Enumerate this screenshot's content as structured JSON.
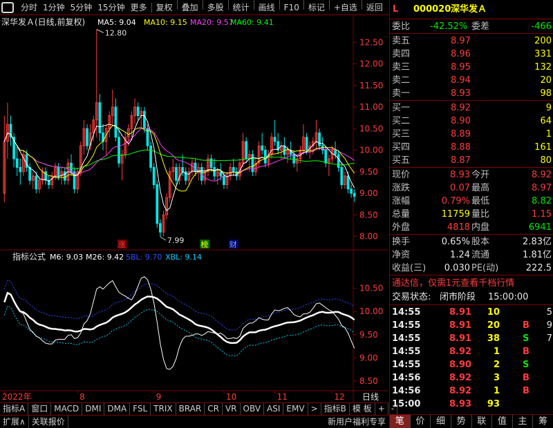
{
  "toolbar": {
    "periods": [
      "分时",
      "1分钟",
      "5分钟",
      "15分钟",
      "更多"
    ],
    "tools": [
      "复权",
      "叠加",
      "多股",
      "统计",
      "画线",
      "F10",
      "标记",
      "+自选",
      "返回"
    ]
  },
  "main_header": {
    "title": "深华发Ａ(日线,前复权)",
    "ma5": "MA5: 9.04",
    "ma10": "MA10: 9.15",
    "ma20": "MA20: 9.57",
    "ma60": "MA60: 9.41"
  },
  "sub_header": {
    "title": "指标公式",
    "m6": "M6: 9.03",
    "m26": "M26: 9.42",
    "sbl": "SBL: 9.70",
    "xbl": "XBL: 9.14"
  },
  "annotations": {
    "high": "12.80",
    "low": "7.99",
    "tag_zhang": "涨",
    "tag_bang": "榜",
    "tag_cai": "财"
  },
  "colors": {
    "up": "#ff3c3c",
    "down": "#00e6e6",
    "ma5": "#ffffff",
    "ma10": "#ffff00",
    "ma20": "#ff40ff",
    "ma60": "#00ff00"
  },
  "chart_data": [
    {
      "type": "candlestick",
      "title": "深华发Ａ(日线,前复权)",
      "yticks": [
        8.0,
        8.5,
        9.0,
        9.5,
        10.0,
        10.5,
        11.0,
        11.5,
        12.0,
        12.5
      ],
      "ylim": [
        7.8,
        13.0
      ],
      "x_labels": [
        "2022年",
        "8",
        "9",
        "10",
        "11",
        "12"
      ],
      "x_label_positions": [
        0,
        23,
        47,
        69,
        85,
        103
      ],
      "candles": [
        [
          9.0,
          10.8,
          8.8,
          10.2
        ],
        [
          10.2,
          11.1,
          9.8,
          10.6
        ],
        [
          10.6,
          10.8,
          10.1,
          10.3
        ],
        [
          10.3,
          10.4,
          9.6,
          9.8
        ],
        [
          9.8,
          10.1,
          9.4,
          9.6
        ],
        [
          9.6,
          9.8,
          9.2,
          9.5
        ],
        [
          9.5,
          10.0,
          9.4,
          9.9
        ],
        [
          9.9,
          10.0,
          9.5,
          9.6
        ],
        [
          9.6,
          9.7,
          9.2,
          9.3
        ],
        [
          9.3,
          9.5,
          9.1,
          9.4
        ],
        [
          9.4,
          9.5,
          9.0,
          9.1
        ],
        [
          9.1,
          9.4,
          9.0,
          9.3
        ],
        [
          9.3,
          9.6,
          9.2,
          9.5
        ],
        [
          9.5,
          9.6,
          9.2,
          9.3
        ],
        [
          9.3,
          9.4,
          9.1,
          9.2
        ],
        [
          9.2,
          9.5,
          9.1,
          9.4
        ],
        [
          9.4,
          9.7,
          9.3,
          9.6
        ],
        [
          9.6,
          9.7,
          9.3,
          9.4
        ],
        [
          9.4,
          9.6,
          9.2,
          9.5
        ],
        [
          9.5,
          9.6,
          9.2,
          9.3
        ],
        [
          9.3,
          9.8,
          9.2,
          9.7
        ],
        [
          9.7,
          9.9,
          9.4,
          9.5
        ],
        [
          9.5,
          9.6,
          9.0,
          9.1
        ],
        [
          9.1,
          9.6,
          9.0,
          9.5
        ],
        [
          9.5,
          10.2,
          9.4,
          10.1
        ],
        [
          10.1,
          10.7,
          9.9,
          10.5
        ],
        [
          10.5,
          10.6,
          10.0,
          10.1
        ],
        [
          10.1,
          10.6,
          10.0,
          10.4
        ],
        [
          10.4,
          10.8,
          10.2,
          10.7
        ],
        [
          10.7,
          12.8,
          10.3,
          11.1
        ],
        [
          11.1,
          11.3,
          10.2,
          10.4
        ],
        [
          10.4,
          10.6,
          10.0,
          10.2
        ],
        [
          10.2,
          10.6,
          9.9,
          10.5
        ],
        [
          10.5,
          10.9,
          10.3,
          10.8
        ],
        [
          10.8,
          11.4,
          10.6,
          11.0
        ],
        [
          11.0,
          11.2,
          10.2,
          10.3
        ],
        [
          10.3,
          10.5,
          9.6,
          9.7
        ],
        [
          9.7,
          10.0,
          9.3,
          9.9
        ],
        [
          9.9,
          10.4,
          9.8,
          10.3
        ],
        [
          10.3,
          10.6,
          10.1,
          10.5
        ],
        [
          10.5,
          10.9,
          10.3,
          10.8
        ],
        [
          10.8,
          11.2,
          10.6,
          11.0
        ],
        [
          11.0,
          11.1,
          10.7,
          10.8
        ],
        [
          10.8,
          11.0,
          10.5,
          10.9
        ],
        [
          10.9,
          11.0,
          10.4,
          10.5
        ],
        [
          10.5,
          10.6,
          10.0,
          10.1
        ],
        [
          10.1,
          10.2,
          9.5,
          9.6
        ],
        [
          9.6,
          9.7,
          9.1,
          9.2
        ],
        [
          9.2,
          9.3,
          8.2,
          8.3
        ],
        [
          8.3,
          8.4,
          7.99,
          8.1
        ],
        [
          8.1,
          8.6,
          8.0,
          8.5
        ],
        [
          8.5,
          9.0,
          8.4,
          8.9
        ],
        [
          8.9,
          9.6,
          8.8,
          9.5
        ],
        [
          9.5,
          9.8,
          9.3,
          9.6
        ],
        [
          9.6,
          9.7,
          9.2,
          9.3
        ],
        [
          9.3,
          9.7,
          9.2,
          9.6
        ],
        [
          9.6,
          9.9,
          9.4,
          9.5
        ],
        [
          9.5,
          9.6,
          9.2,
          9.3
        ],
        [
          9.3,
          9.6,
          9.2,
          9.5
        ],
        [
          9.5,
          9.8,
          9.4,
          9.7
        ],
        [
          9.7,
          9.8,
          9.4,
          9.5
        ],
        [
          9.5,
          9.7,
          9.3,
          9.6
        ],
        [
          9.6,
          9.7,
          9.2,
          9.3
        ],
        [
          9.3,
          9.6,
          9.2,
          9.5
        ],
        [
          9.5,
          9.9,
          9.4,
          9.8
        ],
        [
          9.8,
          9.9,
          9.5,
          9.6
        ],
        [
          9.6,
          9.8,
          9.3,
          9.4
        ],
        [
          9.4,
          9.6,
          9.2,
          9.5
        ],
        [
          9.5,
          9.7,
          9.3,
          9.4
        ],
        [
          9.4,
          9.5,
          9.1,
          9.2
        ],
        [
          9.2,
          9.5,
          9.1,
          9.4
        ],
        [
          9.4,
          9.7,
          9.3,
          9.6
        ],
        [
          9.6,
          9.8,
          9.4,
          9.5
        ],
        [
          9.5,
          9.6,
          9.3,
          9.4
        ],
        [
          9.4,
          9.8,
          9.3,
          9.7
        ],
        [
          9.7,
          10.4,
          9.6,
          10.2
        ],
        [
          10.2,
          10.3,
          9.7,
          9.8
        ],
        [
          9.8,
          10.0,
          9.5,
          9.9
        ],
        [
          9.9,
          10.0,
          9.4,
          9.5
        ],
        [
          9.5,
          9.8,
          9.4,
          9.7
        ],
        [
          9.7,
          10.2,
          9.6,
          10.1
        ],
        [
          10.1,
          10.4,
          9.9,
          10.0
        ],
        [
          10.0,
          10.1,
          9.6,
          9.7
        ],
        [
          9.7,
          10.0,
          9.6,
          9.9
        ],
        [
          9.9,
          10.4,
          9.8,
          10.3
        ],
        [
          10.3,
          10.7,
          10.1,
          10.2
        ],
        [
          10.2,
          10.4,
          9.9,
          10.0
        ],
        [
          10.0,
          10.2,
          9.8,
          10.1
        ],
        [
          10.1,
          10.3,
          9.8,
          9.9
        ],
        [
          9.9,
          10.1,
          9.7,
          10.0
        ],
        [
          10.0,
          10.2,
          9.8,
          9.9
        ],
        [
          9.9,
          10.0,
          9.6,
          9.7
        ],
        [
          9.7,
          9.9,
          9.5,
          9.8
        ],
        [
          9.8,
          10.1,
          9.7,
          10.0
        ],
        [
          10.0,
          10.6,
          9.9,
          10.3
        ],
        [
          10.3,
          10.4,
          9.9,
          10.0
        ],
        [
          10.0,
          10.2,
          9.8,
          10.1
        ],
        [
          10.1,
          10.3,
          9.9,
          10.2
        ],
        [
          10.2,
          10.7,
          10.0,
          10.4
        ],
        [
          10.4,
          10.5,
          10.0,
          10.1
        ],
        [
          10.1,
          10.3,
          9.9,
          10.0
        ],
        [
          10.0,
          10.1,
          9.6,
          9.7
        ],
        [
          9.7,
          9.9,
          9.4,
          9.8
        ],
        [
          9.8,
          10.1,
          9.7,
          10.0
        ],
        [
          10.0,
          10.2,
          9.8,
          9.9
        ],
        [
          9.9,
          10.0,
          9.5,
          9.6
        ],
        [
          9.6,
          9.7,
          9.1,
          9.2
        ],
        [
          9.2,
          9.5,
          9.1,
          9.4
        ],
        [
          9.4,
          9.5,
          9.0,
          9.1
        ],
        [
          9.1,
          9.2,
          8.9,
          9.0
        ],
        [
          9.0,
          9.1,
          8.8,
          8.93
        ]
      ]
    },
    {
      "type": "line",
      "title": "指标公式",
      "yticks": [
        8.5,
        9.0,
        9.5,
        10.0,
        10.5
      ],
      "ylim": [
        8.35,
        11.15
      ],
      "series": [
        {
          "name": "M6",
          "color": "#ffffff"
        },
        {
          "name": "M26",
          "color": "#ffffff"
        },
        {
          "name": "SBL",
          "color": "#3050ff"
        },
        {
          "name": "XBL",
          "color": "#00d0ff"
        }
      ]
    }
  ],
  "quote": {
    "code": "000020",
    "name": "深华发Ａ",
    "weibi_label": "委比",
    "weibi": "-42.52%",
    "weicha_label": "委差",
    "weicha": "-466",
    "asks": [
      {
        "label": "卖五",
        "price": "8.97",
        "vol": "200"
      },
      {
        "label": "卖四",
        "price": "8.96",
        "vol": "331"
      },
      {
        "label": "卖三",
        "price": "8.95",
        "vol": "132"
      },
      {
        "label": "卖二",
        "price": "8.94",
        "vol": "20"
      },
      {
        "label": "卖一",
        "price": "8.93",
        "vol": "98"
      }
    ],
    "bids": [
      {
        "label": "买一",
        "price": "8.92",
        "vol": "9"
      },
      {
        "label": "买二",
        "price": "8.90",
        "vol": "64"
      },
      {
        "label": "买三",
        "price": "8.89",
        "vol": "1"
      },
      {
        "label": "买四",
        "price": "8.88",
        "vol": "161"
      },
      {
        "label": "买五",
        "price": "8.87",
        "vol": "80"
      }
    ],
    "stats": [
      {
        "l1": "现价",
        "v1": "8.93",
        "c1": "red",
        "l2": "今开",
        "v2": "8.92",
        "c2": "red"
      },
      {
        "l1": "涨跌",
        "v1": "0.07",
        "c1": "red",
        "l2": "最高",
        "v2": "8.97",
        "c2": "red"
      },
      {
        "l1": "涨幅",
        "v1": "0.79%",
        "c1": "red",
        "l2": "最低",
        "v2": "8.82",
        "c2": "green"
      },
      {
        "l1": "总量",
        "v1": "11759",
        "c1": "yellow",
        "l2": "量比",
        "v2": "1.15",
        "c2": "red"
      },
      {
        "l1": "外盘",
        "v1": "4818",
        "c1": "red",
        "l2": "内盘",
        "v2": "6941",
        "c2": "green"
      }
    ],
    "stats2": [
      {
        "l1": "换手",
        "v1": "0.65%",
        "l2": "股本",
        "v2": "2.83亿"
      },
      {
        "l1": "净资",
        "v1": "1.24",
        "l2": "流通",
        "v2": "1.81亿"
      },
      {
        "l1": "收益(三)",
        "v1": "0.030",
        "l2": "PE(动)",
        "v2": "222.5"
      }
    ],
    "promo": "通达信，仅需1元查看千档行情",
    "trade_status_label": "交易状态:",
    "trade_status": "闭市阶段",
    "trade_time": "15:00:00",
    "ticks": [
      {
        "t": "14:55",
        "p": "8.91",
        "v": "10",
        "s": "",
        "vc": "yellow"
      },
      {
        "t": "14:55",
        "p": "8.91",
        "v": "20",
        "s": "B",
        "vc": "yellow"
      },
      {
        "t": "14:55",
        "p": "8.91",
        "v": "38",
        "s": "S",
        "vc": "yellow"
      },
      {
        "t": "14:55",
        "p": "8.92",
        "v": "1",
        "s": "B",
        "vc": "yellow"
      },
      {
        "t": "14:55",
        "p": "8.90",
        "v": "2",
        "s": "S",
        "vc": "yellow"
      },
      {
        "t": "14:56",
        "p": "8.92",
        "v": "3",
        "s": "B",
        "vc": "yellow"
      },
      {
        "t": "14:56",
        "p": "8.92",
        "v": "1",
        "s": "B",
        "vc": "yellow"
      },
      {
        "t": "15:00",
        "p": "8.93",
        "v": "93",
        "s": "",
        "vc": "yellow"
      }
    ],
    "tick_extra": [
      "5",
      "9",
      "7",
      "",
      "",
      "",
      "",
      ""
    ]
  },
  "bottom_tabs": [
    "指标A",
    "窗口",
    "MACD",
    "DMI",
    "DMA",
    "FSL",
    "TRIX",
    "BRAR",
    "CR",
    "VR",
    "OBV",
    "ASI",
    "EMV",
    ">",
    "指标B",
    "模 板",
    "+",
    "-"
  ],
  "period_label": "日线",
  "status_items": [
    "扩展∧",
    "关联报价"
  ],
  "status_right": "新用户福利专享",
  "right_tabs": [
    "笔",
    "价",
    "细",
    "势",
    "联",
    "值",
    "主",
    "筹"
  ]
}
